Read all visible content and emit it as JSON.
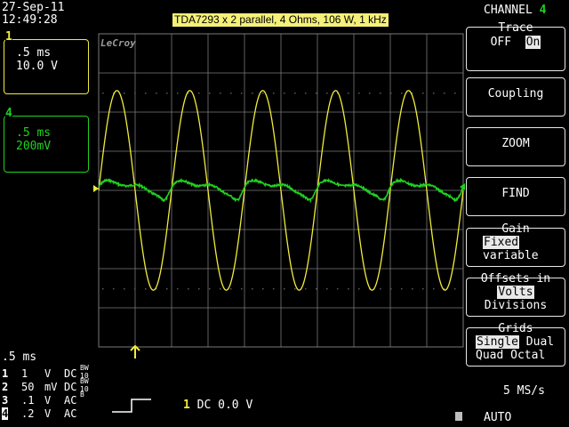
{
  "header": {
    "date": "27-Sep-11",
    "time": "12:49:28",
    "title": "TDA7293 x 2 parallel, 4 Ohms, 106 W, 1 kHz",
    "logo": "LeCroy"
  },
  "channel_boxes": [
    {
      "number": "1",
      "timebase": ".5 ms",
      "volts": "10.0 V",
      "color": "#f0ec3c"
    },
    {
      "number": "4",
      "timebase": ".5 ms",
      "volts": "200mV",
      "color": "#20d020"
    }
  ],
  "menu": {
    "header_label": "CHANNEL",
    "header_channel": "4",
    "trace": {
      "title": "Trace",
      "off": "OFF",
      "on": "On"
    },
    "coupling": "Coupling",
    "zoom": "ZOOM",
    "find": "FIND",
    "gain": {
      "title": "Gain",
      "fixed": "Fixed",
      "variable": "variable"
    },
    "offsets": {
      "title": "Offsets in",
      "volts": "Volts",
      "divisions": "Divisions"
    },
    "grids": {
      "title": "Grids",
      "single": "Single",
      "dual": "Dual",
      "quad": "Quad",
      "octal": "Octal"
    }
  },
  "bottom": {
    "timebase": ".5 ms",
    "channels": [
      {
        "n": "1",
        "value": "1",
        "unit": "V",
        "coupling": "DC",
        "coupling_sub": "BW",
        "coupling_tag": "10"
      },
      {
        "n": "2",
        "value": "50",
        "unit": "mV",
        "coupling": "DC",
        "coupling_sub": "BW",
        "coupling_tag": "10"
      },
      {
        "n": "3",
        "value": ".1",
        "unit": "V",
        "coupling": "AC",
        "coupling_sub": "B",
        "coupling_tag": ""
      },
      {
        "n": "4",
        "value": ".2",
        "unit": "V",
        "coupling": "AC",
        "coupling_sub": "",
        "coupling_tag": ""
      }
    ],
    "trigger_channel": "1",
    "trigger_text": "DC 0.0 V",
    "sample_rate": "5 MS/s",
    "mode": "AUTO"
  },
  "chart_data": {
    "type": "line",
    "x_divisions": 10,
    "y_divisions": 8,
    "grid": true,
    "series": [
      {
        "color": "#f0ec3c",
        "cycles": 5,
        "amplitude_div": 2.55,
        "phase": "sine"
      },
      {
        "color": "#20d020",
        "cycles": 5,
        "amplitude_div": 0.2,
        "phase": "distorted"
      }
    ],
    "colors": {
      "grid": "#7a7a7a",
      "ch1": "#f0ec3c",
      "ch4": "#20d020"
    }
  }
}
